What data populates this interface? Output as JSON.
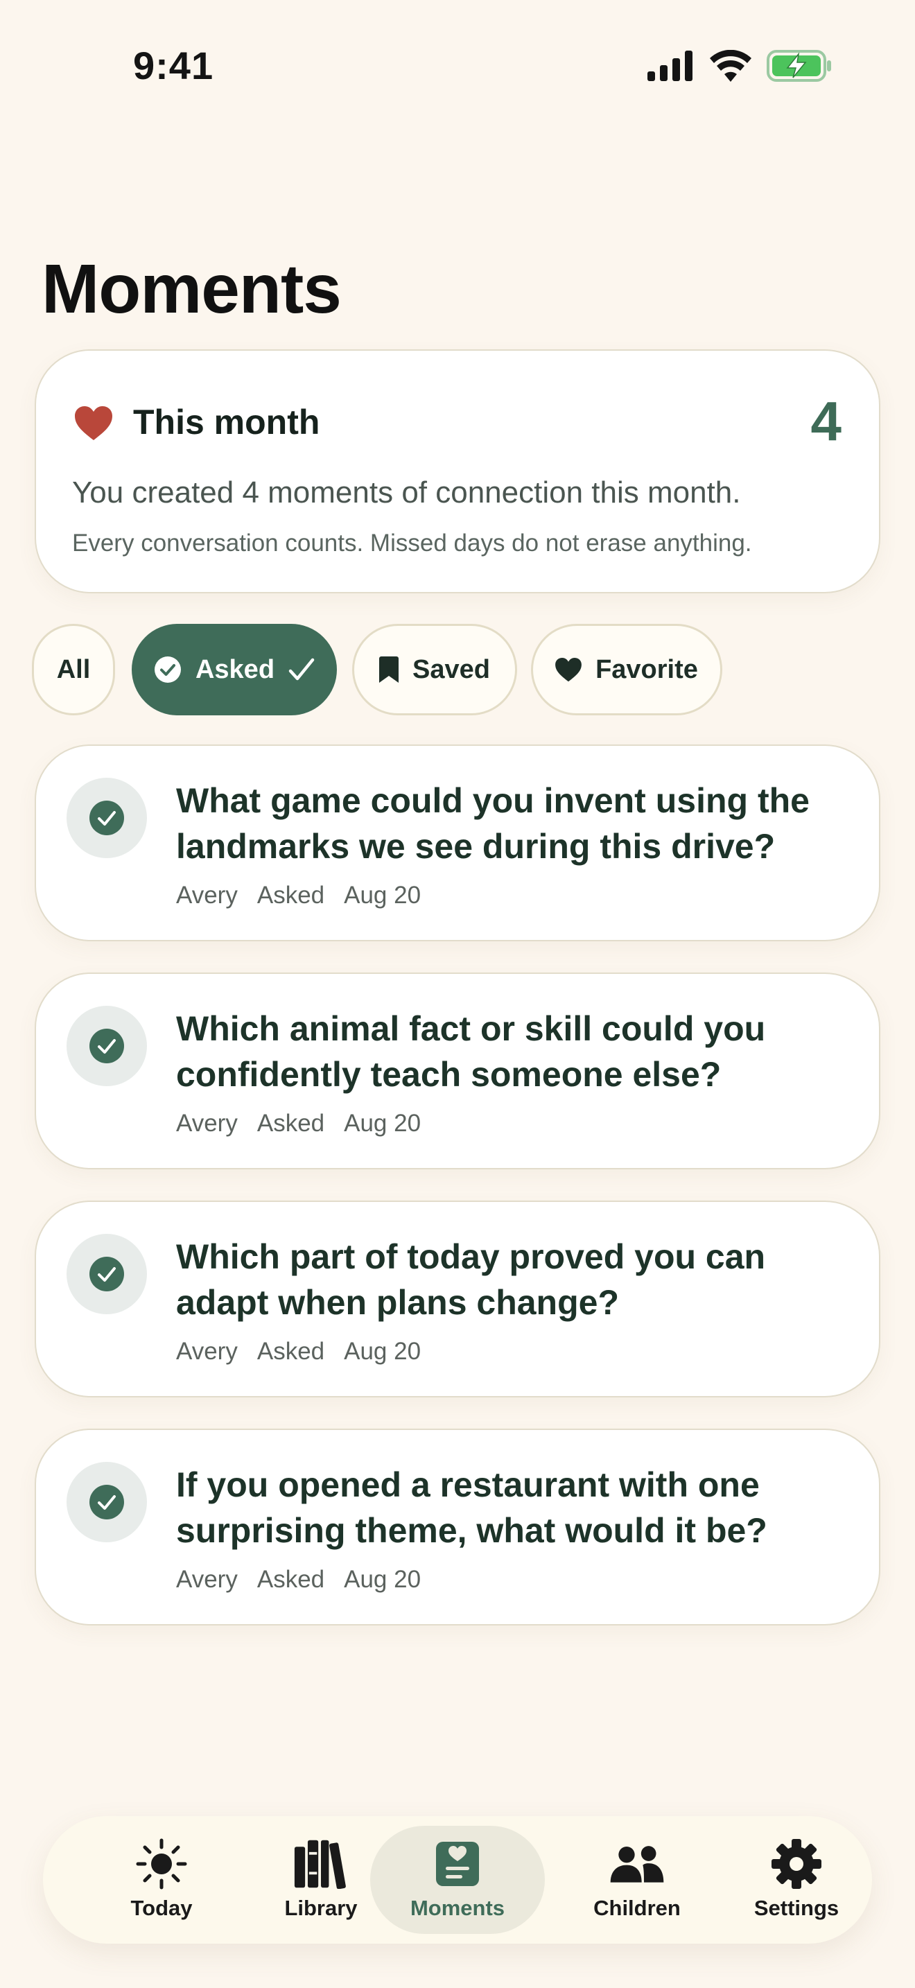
{
  "status": {
    "time": "9:41"
  },
  "page": {
    "title": "Moments"
  },
  "summary": {
    "title": "This month",
    "count": "4",
    "text": "You created 4 moments of connection this month.",
    "note": "Every conversation counts. Missed days do not erase anything."
  },
  "filters": [
    {
      "label": "All",
      "active": false
    },
    {
      "label": "Asked",
      "active": true,
      "icon": "check-circle-icon"
    },
    {
      "label": "Saved",
      "active": false,
      "icon": "bookmark-icon"
    },
    {
      "label": "Favorite",
      "active": false,
      "icon": "heart-icon"
    }
  ],
  "moments": [
    {
      "question": "What game could you invent using the landmarks we see during this drive?",
      "child": "Avery",
      "status": "Asked",
      "date": "Aug 20"
    },
    {
      "question": "Which animal fact or skill could you confidently teach someone else?",
      "child": "Avery",
      "status": "Asked",
      "date": "Aug 20"
    },
    {
      "question": "Which part of today proved you can adapt when plans change?",
      "child": "Avery",
      "status": "Asked",
      "date": "Aug 20"
    },
    {
      "question": "If you opened a restaurant with one surprising theme, what would it be?",
      "child": "Avery",
      "status": "Asked",
      "date": "Aug 20"
    }
  ],
  "tabs": [
    {
      "label": "Today",
      "icon": "sun-icon"
    },
    {
      "label": "Library",
      "icon": "books-icon"
    },
    {
      "label": "Moments",
      "icon": "journal-heart-icon",
      "active": true
    },
    {
      "label": "Children",
      "icon": "people-icon"
    },
    {
      "label": "Settings",
      "icon": "gear-icon"
    }
  ],
  "colors": {
    "background": "#fcf6ee",
    "accent": "#3f6c59",
    "heart": "#b9473a",
    "card": "#ffffff"
  }
}
